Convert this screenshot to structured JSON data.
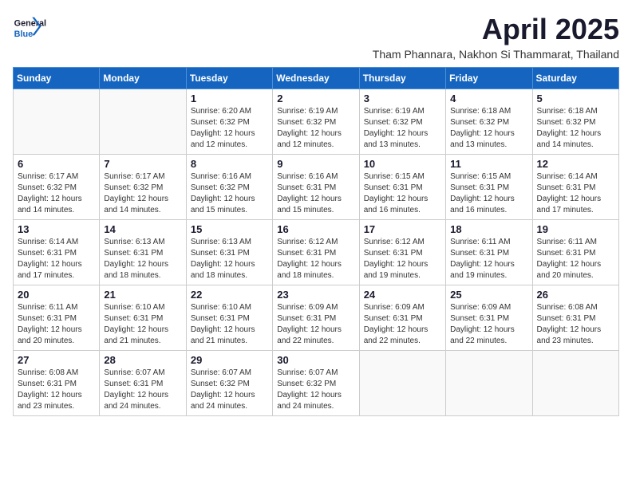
{
  "header": {
    "logo_general": "General",
    "logo_blue": "Blue",
    "month_title": "April 2025",
    "subtitle": "Tham Phannara, Nakhon Si Thammarat, Thailand"
  },
  "weekdays": [
    "Sunday",
    "Monday",
    "Tuesday",
    "Wednesday",
    "Thursday",
    "Friday",
    "Saturday"
  ],
  "weeks": [
    [
      {
        "day": "",
        "info": ""
      },
      {
        "day": "",
        "info": ""
      },
      {
        "day": "1",
        "info": "Sunrise: 6:20 AM\nSunset: 6:32 PM\nDaylight: 12 hours and 12 minutes."
      },
      {
        "day": "2",
        "info": "Sunrise: 6:19 AM\nSunset: 6:32 PM\nDaylight: 12 hours and 12 minutes."
      },
      {
        "day": "3",
        "info": "Sunrise: 6:19 AM\nSunset: 6:32 PM\nDaylight: 12 hours and 13 minutes."
      },
      {
        "day": "4",
        "info": "Sunrise: 6:18 AM\nSunset: 6:32 PM\nDaylight: 12 hours and 13 minutes."
      },
      {
        "day": "5",
        "info": "Sunrise: 6:18 AM\nSunset: 6:32 PM\nDaylight: 12 hours and 14 minutes."
      }
    ],
    [
      {
        "day": "6",
        "info": "Sunrise: 6:17 AM\nSunset: 6:32 PM\nDaylight: 12 hours and 14 minutes."
      },
      {
        "day": "7",
        "info": "Sunrise: 6:17 AM\nSunset: 6:32 PM\nDaylight: 12 hours and 14 minutes."
      },
      {
        "day": "8",
        "info": "Sunrise: 6:16 AM\nSunset: 6:32 PM\nDaylight: 12 hours and 15 minutes."
      },
      {
        "day": "9",
        "info": "Sunrise: 6:16 AM\nSunset: 6:31 PM\nDaylight: 12 hours and 15 minutes."
      },
      {
        "day": "10",
        "info": "Sunrise: 6:15 AM\nSunset: 6:31 PM\nDaylight: 12 hours and 16 minutes."
      },
      {
        "day": "11",
        "info": "Sunrise: 6:15 AM\nSunset: 6:31 PM\nDaylight: 12 hours and 16 minutes."
      },
      {
        "day": "12",
        "info": "Sunrise: 6:14 AM\nSunset: 6:31 PM\nDaylight: 12 hours and 17 minutes."
      }
    ],
    [
      {
        "day": "13",
        "info": "Sunrise: 6:14 AM\nSunset: 6:31 PM\nDaylight: 12 hours and 17 minutes."
      },
      {
        "day": "14",
        "info": "Sunrise: 6:13 AM\nSunset: 6:31 PM\nDaylight: 12 hours and 18 minutes."
      },
      {
        "day": "15",
        "info": "Sunrise: 6:13 AM\nSunset: 6:31 PM\nDaylight: 12 hours and 18 minutes."
      },
      {
        "day": "16",
        "info": "Sunrise: 6:12 AM\nSunset: 6:31 PM\nDaylight: 12 hours and 18 minutes."
      },
      {
        "day": "17",
        "info": "Sunrise: 6:12 AM\nSunset: 6:31 PM\nDaylight: 12 hours and 19 minutes."
      },
      {
        "day": "18",
        "info": "Sunrise: 6:11 AM\nSunset: 6:31 PM\nDaylight: 12 hours and 19 minutes."
      },
      {
        "day": "19",
        "info": "Sunrise: 6:11 AM\nSunset: 6:31 PM\nDaylight: 12 hours and 20 minutes."
      }
    ],
    [
      {
        "day": "20",
        "info": "Sunrise: 6:11 AM\nSunset: 6:31 PM\nDaylight: 12 hours and 20 minutes."
      },
      {
        "day": "21",
        "info": "Sunrise: 6:10 AM\nSunset: 6:31 PM\nDaylight: 12 hours and 21 minutes."
      },
      {
        "day": "22",
        "info": "Sunrise: 6:10 AM\nSunset: 6:31 PM\nDaylight: 12 hours and 21 minutes."
      },
      {
        "day": "23",
        "info": "Sunrise: 6:09 AM\nSunset: 6:31 PM\nDaylight: 12 hours and 22 minutes."
      },
      {
        "day": "24",
        "info": "Sunrise: 6:09 AM\nSunset: 6:31 PM\nDaylight: 12 hours and 22 minutes."
      },
      {
        "day": "25",
        "info": "Sunrise: 6:09 AM\nSunset: 6:31 PM\nDaylight: 12 hours and 22 minutes."
      },
      {
        "day": "26",
        "info": "Sunrise: 6:08 AM\nSunset: 6:31 PM\nDaylight: 12 hours and 23 minutes."
      }
    ],
    [
      {
        "day": "27",
        "info": "Sunrise: 6:08 AM\nSunset: 6:31 PM\nDaylight: 12 hours and 23 minutes."
      },
      {
        "day": "28",
        "info": "Sunrise: 6:07 AM\nSunset: 6:31 PM\nDaylight: 12 hours and 24 minutes."
      },
      {
        "day": "29",
        "info": "Sunrise: 6:07 AM\nSunset: 6:32 PM\nDaylight: 12 hours and 24 minutes."
      },
      {
        "day": "30",
        "info": "Sunrise: 6:07 AM\nSunset: 6:32 PM\nDaylight: 12 hours and 24 minutes."
      },
      {
        "day": "",
        "info": ""
      },
      {
        "day": "",
        "info": ""
      },
      {
        "day": "",
        "info": ""
      }
    ]
  ]
}
